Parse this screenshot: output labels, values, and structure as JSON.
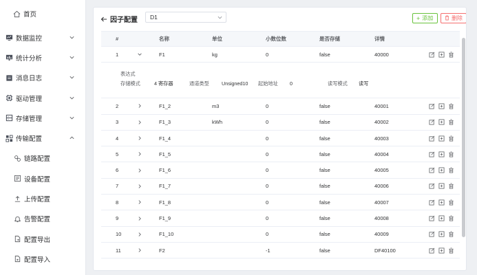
{
  "sidebar": {
    "home": "首页",
    "items": [
      {
        "label": "数据监控",
        "icon": "monitor-icon"
      },
      {
        "label": "统计分析",
        "icon": "chart-icon"
      },
      {
        "label": "消息日志",
        "icon": "log-icon"
      },
      {
        "label": "驱动管理",
        "icon": "chip-icon"
      },
      {
        "label": "存储管理",
        "icon": "storage-icon"
      },
      {
        "label": "传输配置",
        "icon": "transfer-icon"
      }
    ],
    "subitems": [
      {
        "label": "链路配置",
        "icon": "link-icon"
      },
      {
        "label": "设备配置",
        "icon": "device-icon"
      },
      {
        "label": "上传配置",
        "icon": "upload-icon"
      },
      {
        "label": "告警配置",
        "icon": "alarm-icon"
      },
      {
        "label": "配置导出",
        "icon": "export-icon"
      },
      {
        "label": "配置导入",
        "icon": "import-icon"
      }
    ]
  },
  "header": {
    "title": "因子配置",
    "select_value": "D1",
    "add_label": "添加",
    "delete_label": "删除"
  },
  "table": {
    "columns": [
      "#",
      "名称",
      "单位",
      "小数位数",
      "是否存储",
      "详情"
    ],
    "rows": [
      {
        "no": "1",
        "name": "F1",
        "unit": "kg",
        "decimals": "0",
        "store": "false",
        "detail": "40000",
        "expanded": true
      },
      {
        "no": "2",
        "name": "F1_2",
        "unit": "m3",
        "decimals": "0",
        "store": "false",
        "detail": "40001"
      },
      {
        "no": "3",
        "name": "F1_3",
        "unit": "kWh",
        "decimals": "0",
        "store": "false",
        "detail": "40002"
      },
      {
        "no": "4",
        "name": "F1_4",
        "unit": "",
        "decimals": "0",
        "store": "false",
        "detail": "40003"
      },
      {
        "no": "5",
        "name": "F1_5",
        "unit": "",
        "decimals": "0",
        "store": "false",
        "detail": "40004"
      },
      {
        "no": "6",
        "name": "F1_6",
        "unit": "",
        "decimals": "0",
        "store": "false",
        "detail": "40005"
      },
      {
        "no": "7",
        "name": "F1_7",
        "unit": "",
        "decimals": "0",
        "store": "false",
        "detail": "40006"
      },
      {
        "no": "8",
        "name": "F1_8",
        "unit": "",
        "decimals": "0",
        "store": "false",
        "detail": "40007"
      },
      {
        "no": "9",
        "name": "F1_9",
        "unit": "",
        "decimals": "0",
        "store": "false",
        "detail": "40008"
      },
      {
        "no": "10",
        "name": "F1_10",
        "unit": "",
        "decimals": "0",
        "store": "false",
        "detail": "40009"
      },
      {
        "no": "11",
        "name": "F2",
        "unit": "",
        "decimals": "-1",
        "store": "false",
        "detail": "DF40100"
      }
    ],
    "expanded_detail": {
      "expression_label": "表达式",
      "storage_mode_label": "存储模式",
      "storage_mode_value": "4 寄存器",
      "data_type_label": "通道类型",
      "data_type_value": "Unsigned10",
      "start_addr_label": "起始地址",
      "start_addr_value": "0",
      "rw_mode_label": "读写模式",
      "rw_mode_value": "读写"
    }
  },
  "colors": {
    "add": "#67c23a",
    "delete": "#f56c6c",
    "border": "#ebeef5"
  }
}
